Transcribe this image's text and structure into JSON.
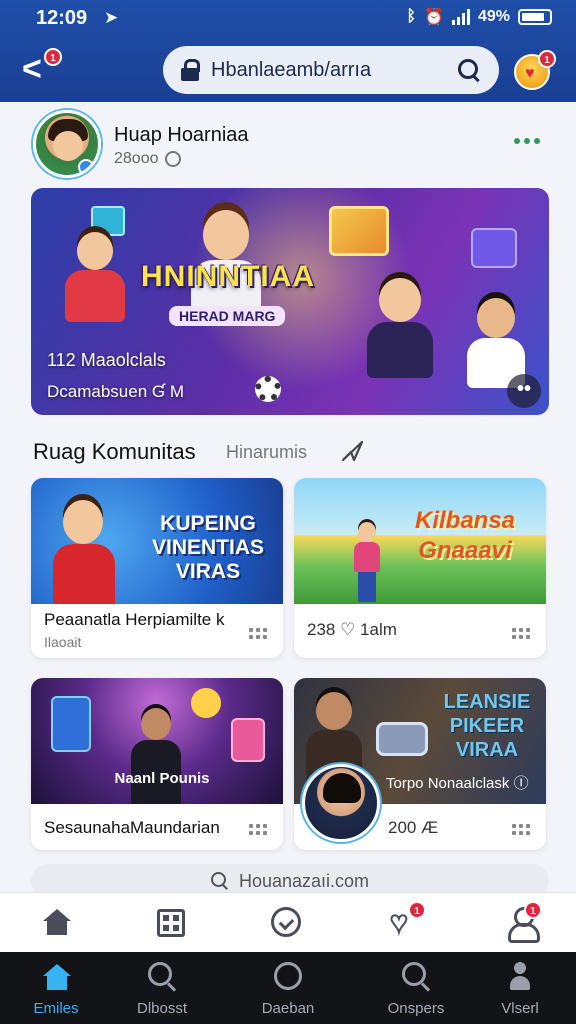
{
  "status_bar": {
    "time": "12:09",
    "battery_text": "49%"
  },
  "browser": {
    "url": "Hbanlaeamb/arrıa",
    "back_badge": "1",
    "profile_badge": "1"
  },
  "post": {
    "author": "Huap Hoarniaa",
    "meta": "28ооо"
  },
  "hero": {
    "title": "HNINNTIAA",
    "subtitle": "HERAD MARG",
    "count": "112 Maaolclals",
    "caption": "Dcamabsuen Ɠ M"
  },
  "section": {
    "title": "Ruag Komunitas",
    "subtitle": "Hinarumis"
  },
  "cards": [
    {
      "image_title": "KUPEING VINENTIAS VIRAS",
      "label": "Peaanatla Herpiamilte k",
      "sublabel": "Ilaoait"
    },
    {
      "image_title": "Kilbansa Gnaaavi",
      "stat": "238 ♡ 1alm"
    },
    {
      "image_title": "Naanl Pounis",
      "label": "SesaunahaMaundarian"
    },
    {
      "image_title": "LEANSIE PIKEER VIRAA",
      "overlay": "Torpo Nonaalclask Ⓘ",
      "stat": "200 Æ"
    }
  ],
  "search_pill": {
    "text": "Houanazaıi.com"
  },
  "upper_nav": {
    "heart_badge": "1",
    "profile_badge": "1"
  },
  "bottom_tabs": [
    {
      "label": "Emiles",
      "active": true
    },
    {
      "label": "Dlbosst",
      "active": false
    },
    {
      "label": "Daeban",
      "active": false
    },
    {
      "label": "Onspers",
      "active": false
    },
    {
      "label": "Vlserl",
      "active": false
    }
  ],
  "colors": {
    "header_blue": "#1f4fa8",
    "badge_red": "#e0263b",
    "active_tab": "#36b3f0",
    "tabbar_bg": "#121418"
  }
}
